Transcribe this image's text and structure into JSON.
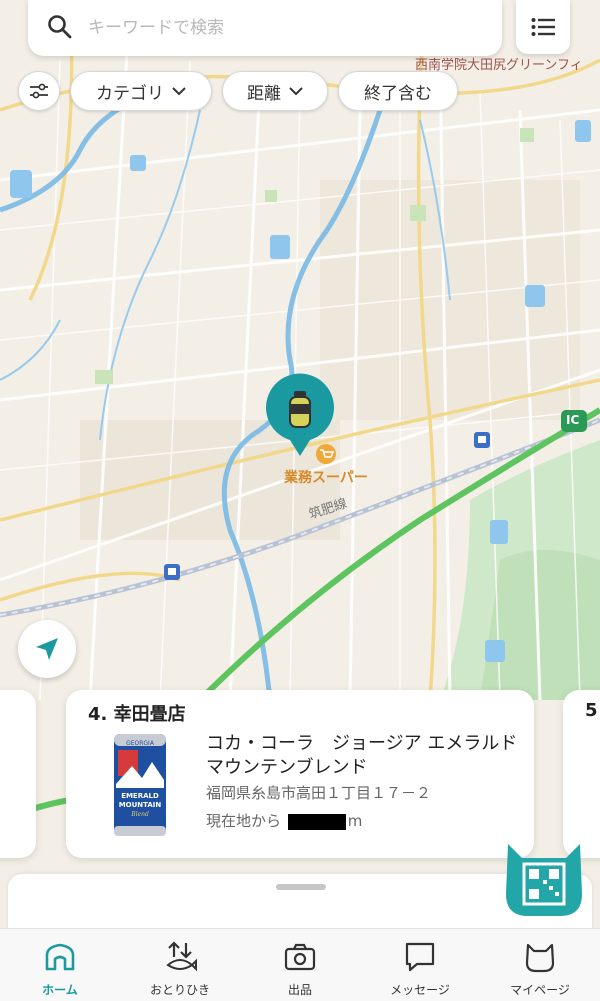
{
  "search": {
    "placeholder": "キーワードで検索"
  },
  "filters": {
    "category": "カテゴリ",
    "distance": "距離",
    "include_ended": "終了含む"
  },
  "map": {
    "labels": {
      "school": "西南学院大田尻グリーンフィ",
      "supermarket": "業務スーパー",
      "railway": "筑肥線",
      "ic": "IC"
    }
  },
  "card": {
    "title": "4. 幸田畳店",
    "product": "コカ・コーラ　ジョージア エメラルドマウンテンブレンド",
    "address": "福岡県糸島市高田１丁目１７－２",
    "distance_prefix": "現在地から",
    "distance_unit": "m",
    "can_brand": "GEORGIA",
    "can_text1": "EMERALD",
    "can_text2": "MOUNTAIN",
    "can_text3": "Blend",
    "next_index": "5"
  },
  "nav": [
    {
      "label": "ホーム",
      "icon": "home-icon"
    },
    {
      "label": "おとりひき",
      "icon": "trade-icon"
    },
    {
      "label": "出品",
      "icon": "camera-icon"
    },
    {
      "label": "メッセージ",
      "icon": "message-icon"
    },
    {
      "label": "マイページ",
      "icon": "cat-icon"
    }
  ],
  "colors": {
    "accent": "#1a9aa0",
    "map_bg": "#f3efe6",
    "road_green": "#5ec45f",
    "water": "#6fb6e8"
  }
}
